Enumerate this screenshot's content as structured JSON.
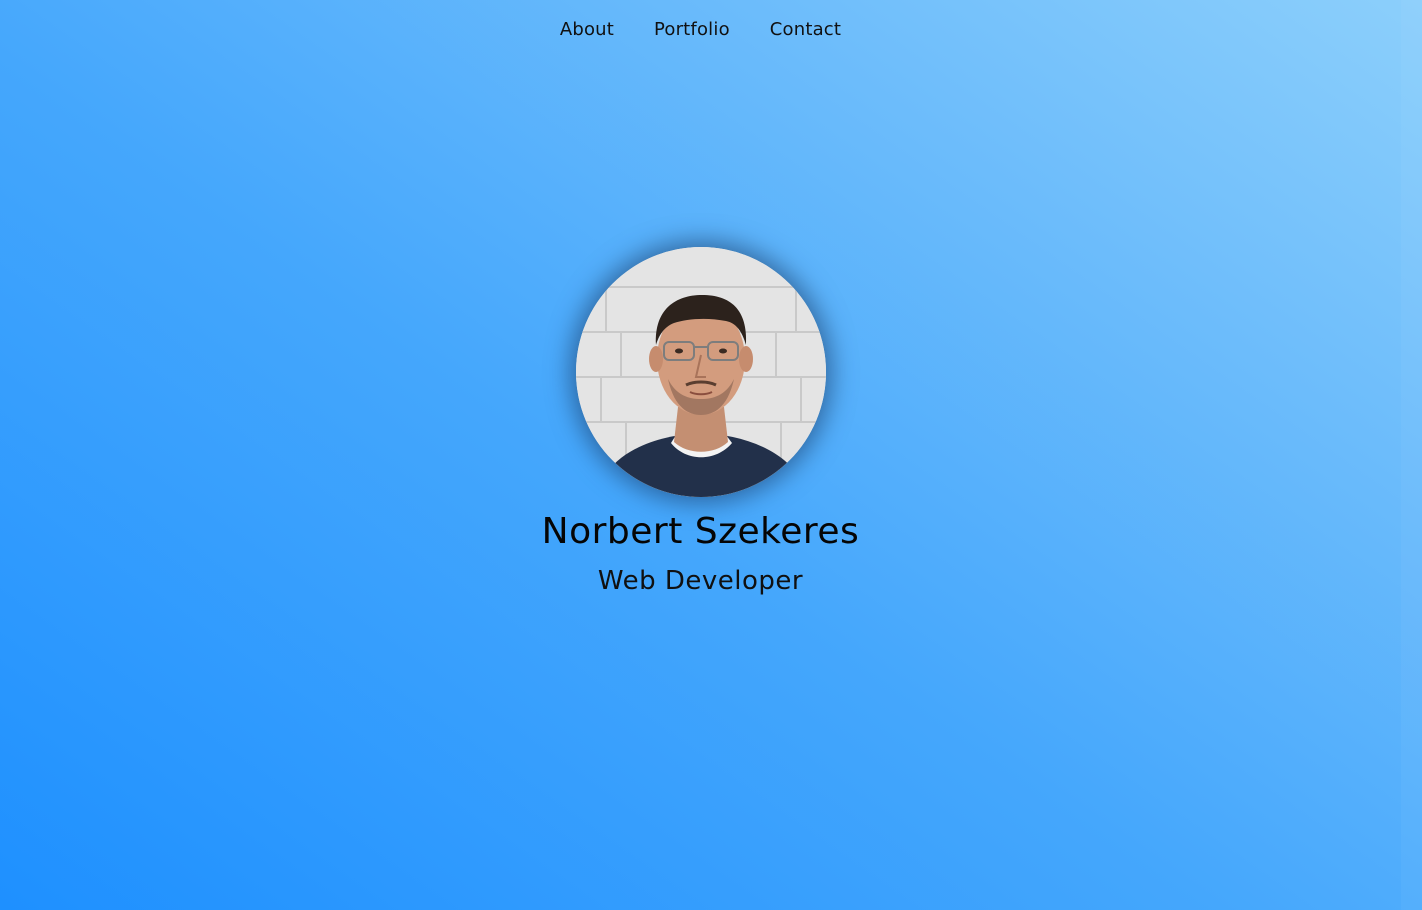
{
  "nav": {
    "items": [
      {
        "label": "About"
      },
      {
        "label": "Portfolio"
      },
      {
        "label": "Contact"
      }
    ]
  },
  "profile": {
    "name": "Norbert Szekeres",
    "role": "Web Developer",
    "avatar_icon": "profile-photo"
  },
  "colors": {
    "gradient_start": "#1e90ff",
    "gradient_end": "#8ccffb",
    "text": "#0a0a0a"
  }
}
